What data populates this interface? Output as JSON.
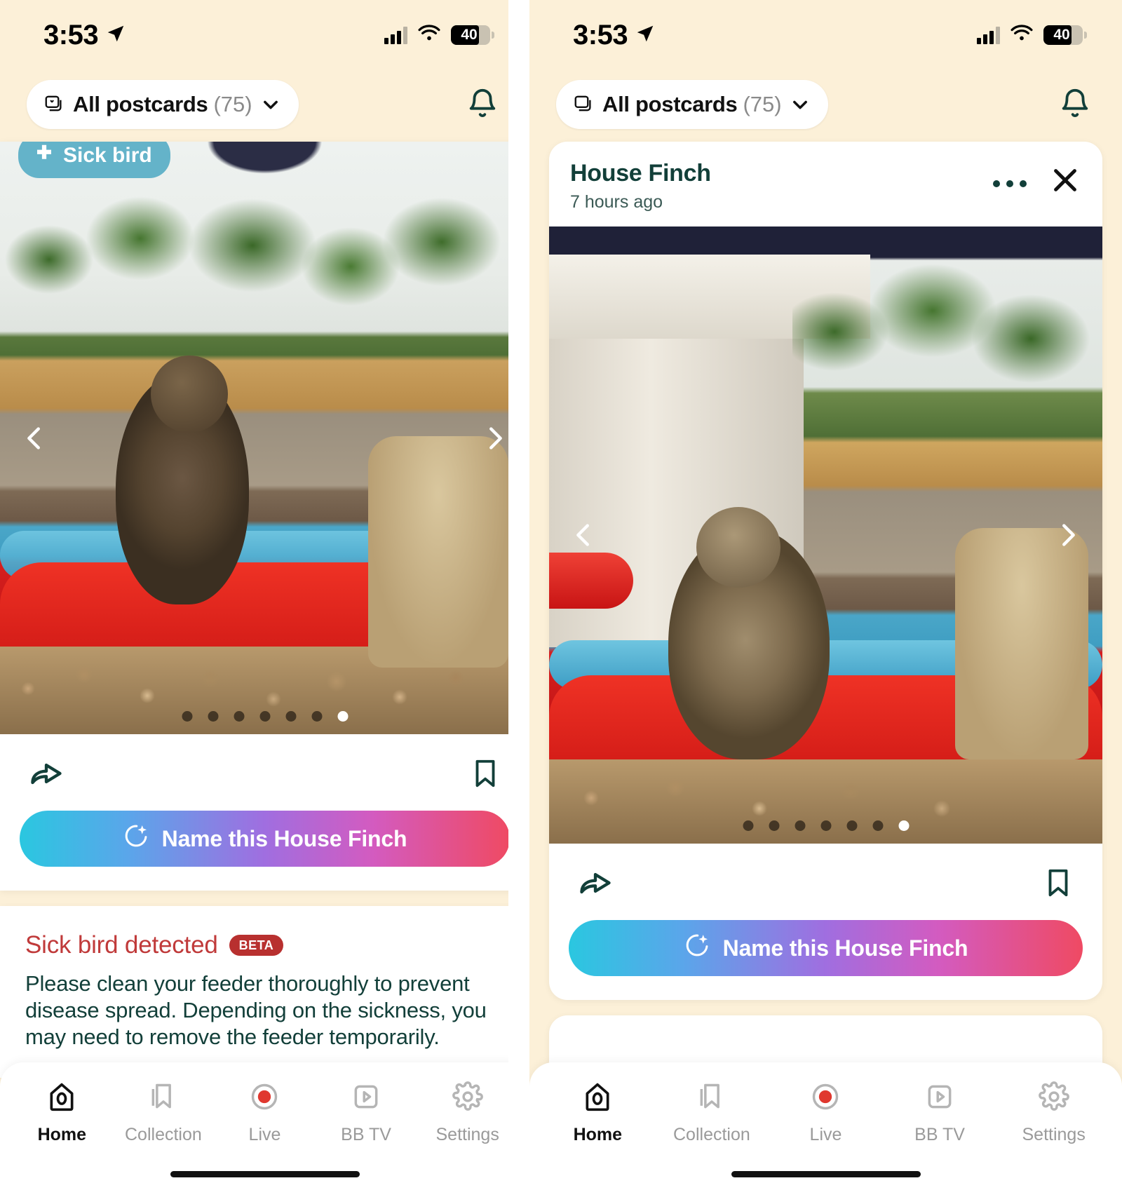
{
  "status_bar": {
    "time": "3:53",
    "location_icon": "location-arrow-icon",
    "cellular_icon": "cellular-bars-icon",
    "wifi_icon": "wifi-icon",
    "battery_level": "40"
  },
  "top_bar": {
    "filter_chip": {
      "icon": "postcards-stack-icon",
      "label": "All postcards",
      "count": "(75)",
      "chevron": "chevron-down-icon"
    },
    "notifications_icon": "bell-icon"
  },
  "colors": {
    "background": "#FCF0D8",
    "card": "#FFFFFF",
    "brand_dark_green": "#123F39",
    "alert_red": "#C03A3A",
    "beta_badge": "#B8302F",
    "sick_badge": "#64B3C9",
    "cta_gradient_start": "#2AC7E0",
    "cta_gradient_end": "#EF4A63",
    "tab_inactive": "#9A9A9A",
    "tab_active": "#111111"
  },
  "left_screen": {
    "sick_badge": {
      "icon": "medical-cross-icon",
      "label": "Sick bird"
    },
    "photo": {
      "alt": "House Finch perched on red bird feeder",
      "prev_arrow": "chevron-left-icon",
      "next_arrow": "chevron-right-icon",
      "pager_total": 7,
      "pager_active_index": 6
    },
    "actions": {
      "share_icon": "share-arrow-icon",
      "bookmark_icon": "bookmark-icon"
    },
    "cta": {
      "icon": "sparkle-ai-icon",
      "label": "Name this House Finch"
    },
    "alert": {
      "title": "Sick bird detected",
      "badge": "BETA",
      "body": "Please clean your feeder thoroughly to prevent disease spread. Depending on the sickness, you may need to remove the feeder temporarily."
    }
  },
  "right_screen": {
    "card_header": {
      "title": "House Finch",
      "timestamp": "7 hours ago",
      "more_icon": "more-horizontal-icon",
      "close_icon": "close-icon"
    },
    "photo": {
      "alt": "House Finch with open beak at red bird feeder",
      "prev_arrow": "chevron-left-icon",
      "next_arrow": "chevron-right-icon",
      "pager_total": 7,
      "pager_active_index": 6
    },
    "actions": {
      "share_icon": "share-arrow-icon",
      "bookmark_icon": "bookmark-icon"
    },
    "cta": {
      "icon": "sparkle-ai-icon",
      "label": "Name this House Finch"
    }
  },
  "tab_bar": {
    "items": [
      {
        "label": "Home",
        "icon": "home-birdhouse-icon",
        "active": true
      },
      {
        "label": "Collection",
        "icon": "collection-bookmark-icon",
        "active": false
      },
      {
        "label": "Live",
        "icon": "live-record-icon",
        "active": false
      },
      {
        "label": "BB TV",
        "icon": "play-video-icon",
        "active": false
      },
      {
        "label": "Settings",
        "icon": "gear-icon",
        "active": false
      }
    ]
  }
}
